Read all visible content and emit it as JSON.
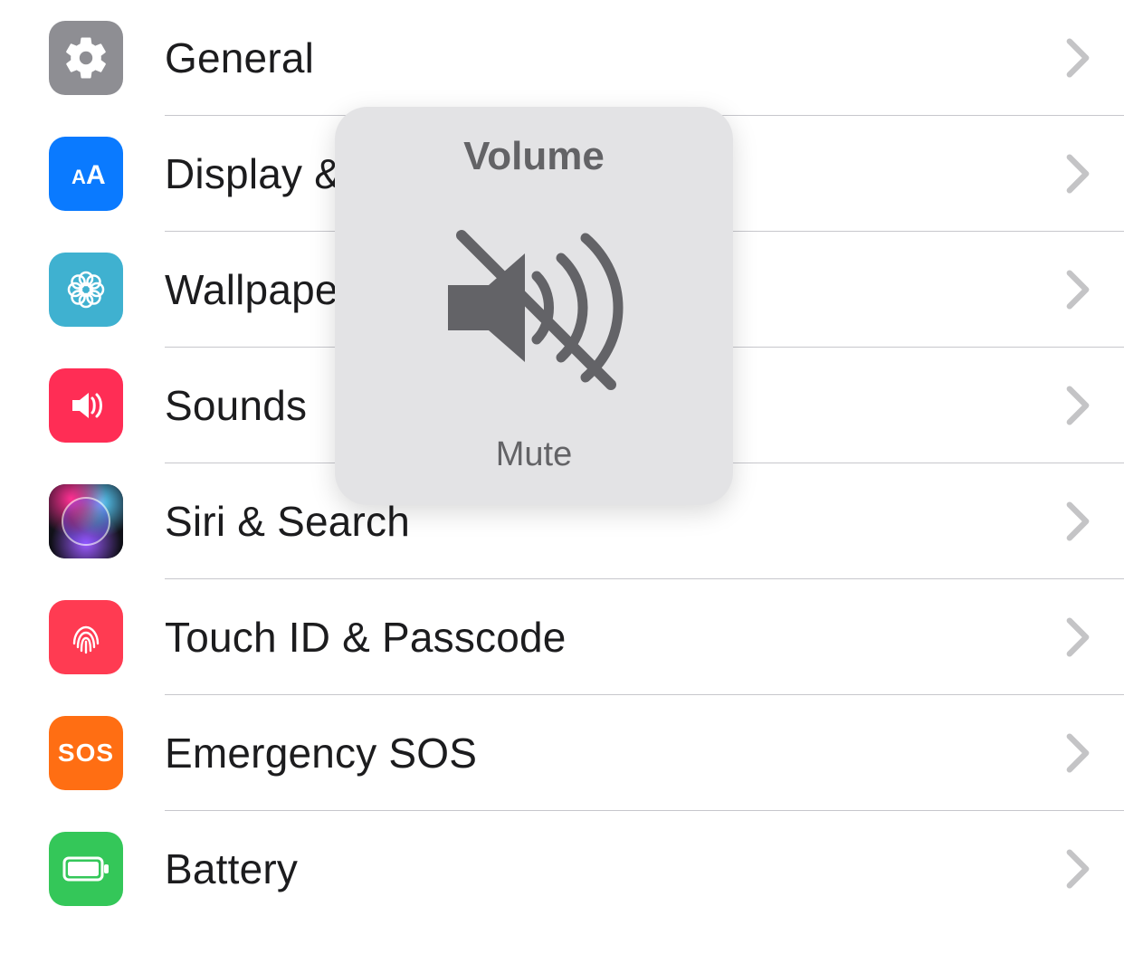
{
  "settings": {
    "items": [
      {
        "key": "general",
        "label": "General"
      },
      {
        "key": "display",
        "label": "Display & Brightness"
      },
      {
        "key": "wallpaper",
        "label": "Wallpaper"
      },
      {
        "key": "sounds",
        "label": "Sounds"
      },
      {
        "key": "siri",
        "label": "Siri & Search"
      },
      {
        "key": "touchid",
        "label": "Touch ID & Passcode"
      },
      {
        "key": "sos",
        "label": "Emergency SOS"
      },
      {
        "key": "battery",
        "label": "Battery"
      }
    ]
  },
  "hud": {
    "title": "Volume",
    "subtitle": "Mute"
  },
  "colors": {
    "separator": "#c7c7cc",
    "chevron": "#c4c4c6",
    "hud_bg": "#e3e3e5",
    "hud_text": "#636366"
  }
}
